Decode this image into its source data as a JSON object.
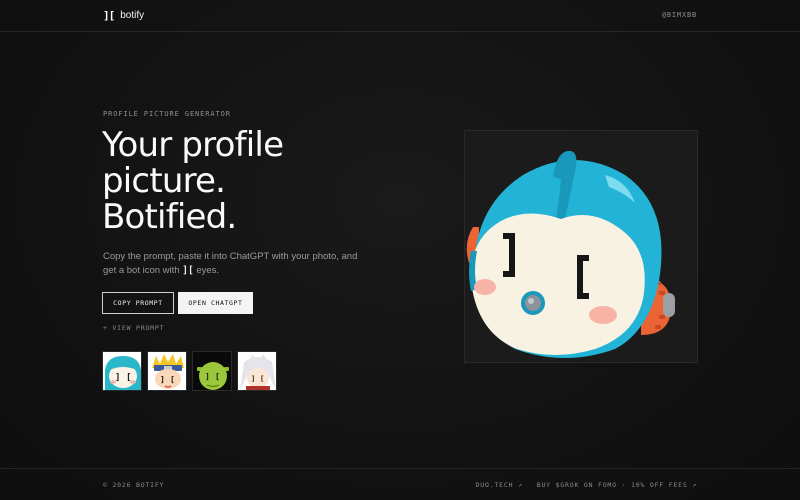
{
  "header": {
    "brand_mark": "][",
    "brand_name": "botify",
    "handle": "@BIMXBB"
  },
  "hero": {
    "eyebrow": "PROFILE PICTURE GENERATOR",
    "headline": [
      "Your profile",
      "picture.",
      "Botified."
    ],
    "description_before": "Copy the prompt, paste it into ChatGPT with your photo, and get a bot icon with",
    "description_mark": "][",
    "description_after": "eyes.",
    "copy_button": "COPY PROMPT",
    "open_button": "OPEN CHATGPT",
    "view_prompt": "+ VIEW PROMPT"
  },
  "examples": [
    {
      "name": "thumb-teal-hair-bot",
      "bg": "#ffffff"
    },
    {
      "name": "thumb-ninja-bot",
      "bg": "#f3c623"
    },
    {
      "name": "thumb-green-ogre-bot",
      "bg": "#0a0a0a"
    },
    {
      "name": "thumb-white-hair-bot",
      "bg": "#ffffff"
    }
  ],
  "preview": {
    "colors": {
      "helmet": "#22b3d6",
      "face": "#f8f2e2",
      "blush": "#f6b3a6",
      "ear": "#ee6a3a",
      "eyes": "#161616"
    }
  },
  "footer": {
    "copyright": "© 2026 BOTIFY",
    "link_1": "DUO.TECH ↗",
    "link_2": "BUY $GROK ON FOMO · 10% OFF FEES ↗"
  }
}
